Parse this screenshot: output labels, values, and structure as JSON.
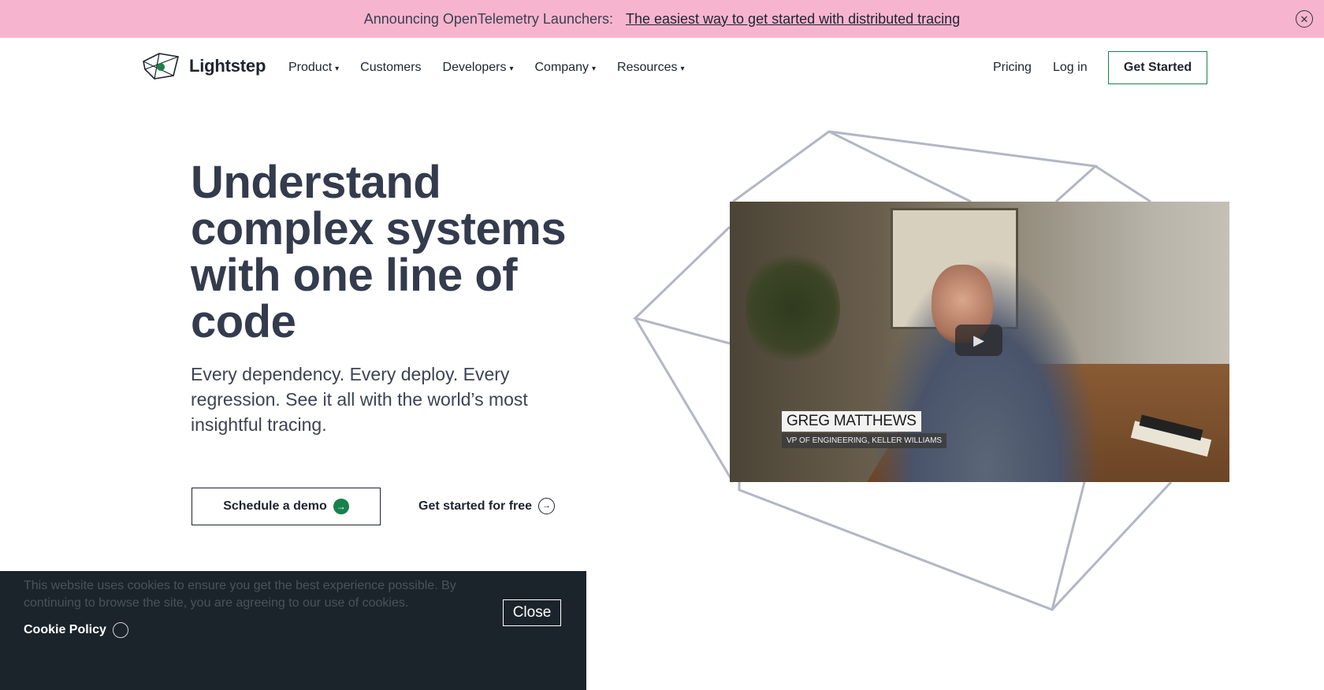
{
  "banner": {
    "label": "Announcing OpenTelemetry Launchers:",
    "link": "The easiest way to get started with distributed tracing",
    "close_icon": "close-icon"
  },
  "nav": {
    "logo_text": "Lightstep",
    "logo_icon": "cube-logo-icon",
    "menu": [
      {
        "label": "Product",
        "has_dropdown": true
      },
      {
        "label": "Customers",
        "has_dropdown": false
      },
      {
        "label": "Developers",
        "has_dropdown": true
      },
      {
        "label": "Company",
        "has_dropdown": true
      },
      {
        "label": "Resources",
        "has_dropdown": true
      }
    ],
    "pricing": "Pricing",
    "login": "Log in",
    "get_started": "Get Started"
  },
  "hero": {
    "title": "Understand complex systems with one line of code",
    "subtitle": "Every dependency. Every deploy. Every regression. See it all with the world’s most insightful tracing.",
    "demo_button": "Schedule a demo",
    "free_link": "Get started for free"
  },
  "video": {
    "name": "GREG MATTHEWS",
    "role": "VP OF ENGINEERING, KELLER WILLIAMS",
    "play_icon": "play-icon"
  },
  "cookie": {
    "text": "This website uses cookies to ensure you get the best experience possible. By continuing to browse the site, you are agreeing to our use of cookies.",
    "policy": "Cookie Policy",
    "close": "Close"
  },
  "colors": {
    "banner_bg": "#f7b4cf",
    "accent_green": "#17814b",
    "heading": "#343b4d",
    "cookie_bg": "#1b242b",
    "geo_lines": "#b3b6c4"
  }
}
